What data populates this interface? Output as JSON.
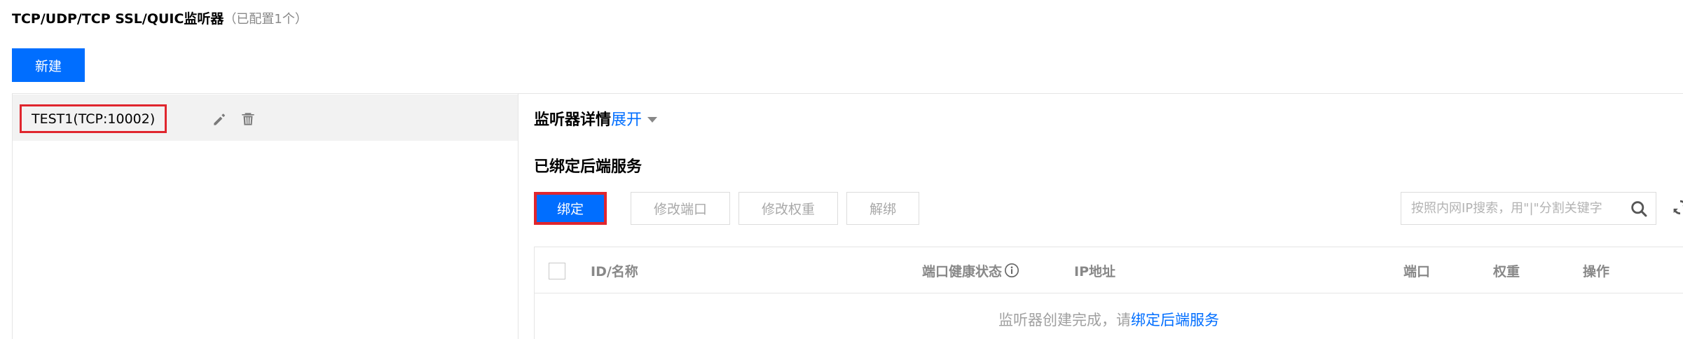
{
  "header": {
    "title": "TCP/UDP/TCP SSL/QUIC监听器",
    "count_text": "（已配置1个）"
  },
  "new_button": "新建",
  "listeners": [
    {
      "name": "TEST1(TCP:10002)"
    }
  ],
  "detail": {
    "title": "监听器详情",
    "expand": "展开"
  },
  "backend": {
    "title": "已绑定后端服务",
    "bind_label": "绑定",
    "modify_port_label": "修改端口",
    "modify_weight_label": "修改权重",
    "unbind_label": "解绑",
    "search_placeholder": "按照内网IP搜索，用\"|\"分割关键字"
  },
  "table": {
    "columns": {
      "id_name": "ID/名称",
      "health": "端口健康状态",
      "ip": "IP地址",
      "port": "端口",
      "weight": "权重",
      "actions": "操作"
    },
    "empty_prefix": "监听器创建完成，请",
    "empty_link": "绑定后端服务"
  },
  "colors": {
    "primary": "#006eff",
    "highlight": "#e0262e"
  },
  "icons": [
    "edit-icon",
    "delete-icon",
    "caret-down-icon",
    "search-icon",
    "refresh-icon",
    "info-icon"
  ]
}
